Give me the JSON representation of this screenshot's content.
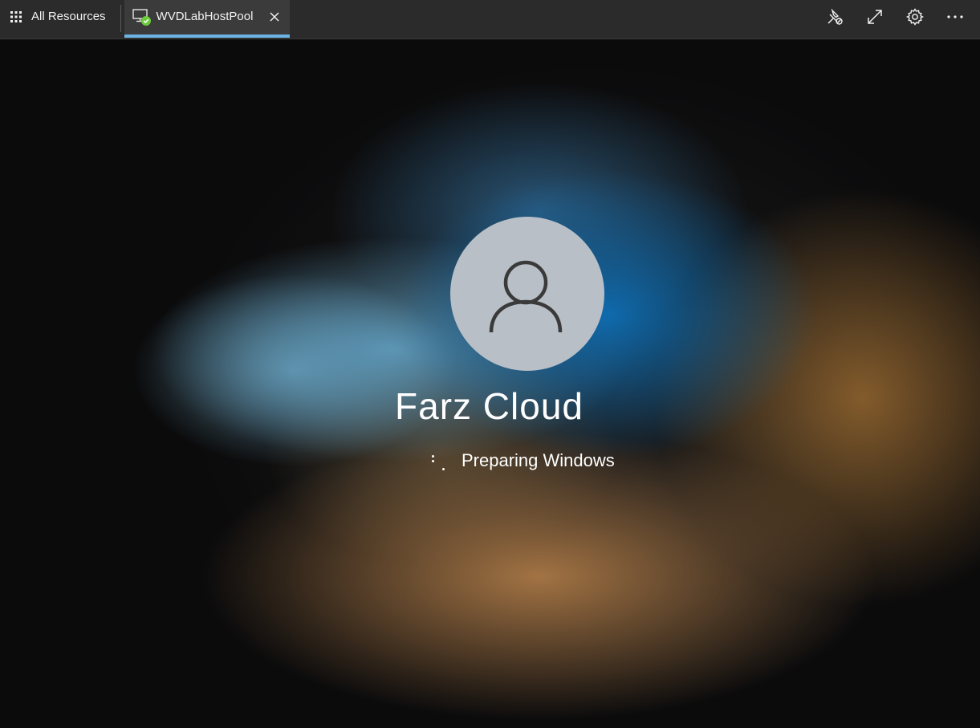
{
  "topbar": {
    "all_resources_label": "All Resources",
    "tab": {
      "label": "WVDLabHostPool",
      "status": "connected"
    },
    "tools": [
      {
        "name": "unpin-icon"
      },
      {
        "name": "fullscreen-icon"
      },
      {
        "name": "settings-icon"
      },
      {
        "name": "more-icon"
      }
    ]
  },
  "session": {
    "username": "Farz Cloud",
    "status_text": "Preparing Windows"
  },
  "colors": {
    "topbar_bg": "#2b2b2b",
    "tab_active_bg": "#3b3b3b",
    "tab_indicator": "#6cb4e4",
    "status_ok": "#6ccb3b",
    "avatar_bg": "#b8bfc7"
  }
}
